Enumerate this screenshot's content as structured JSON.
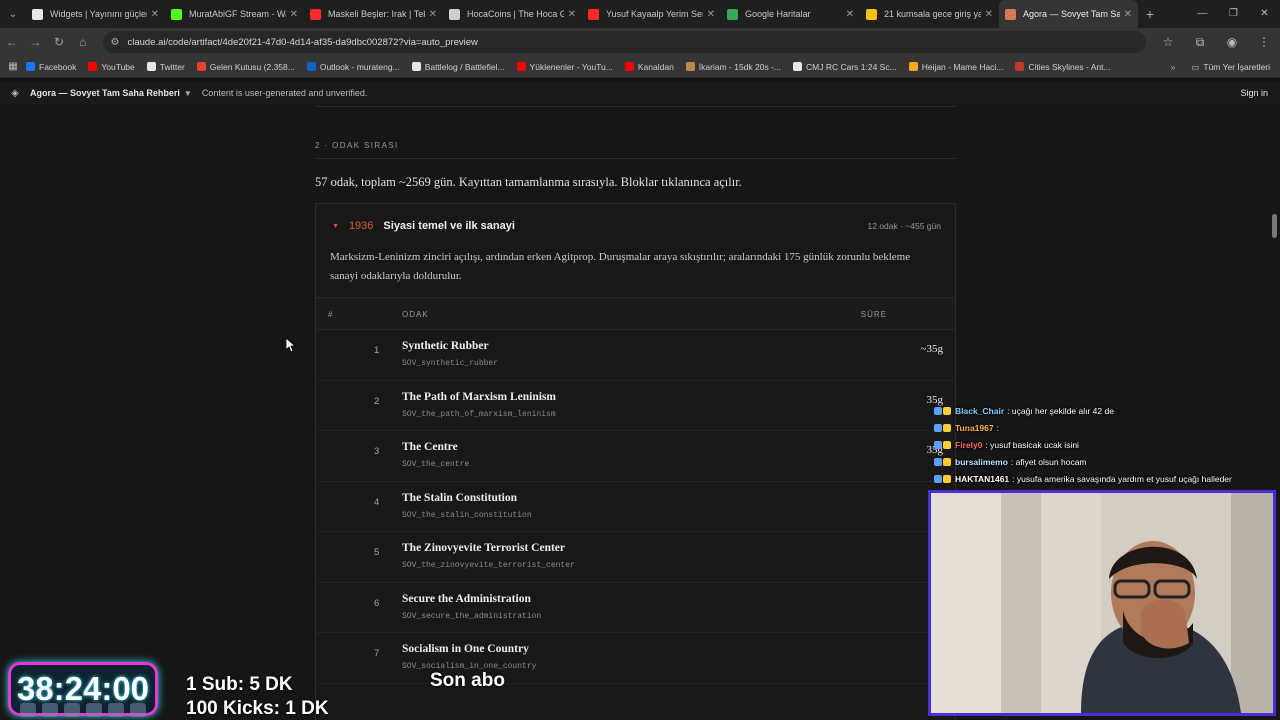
{
  "browser": {
    "tabs": [
      {
        "title": "Widgets | Yayınını güçlen",
        "color": "#e8e8e8"
      },
      {
        "title": "MuratAbiGF Stream - Wa",
        "color": "#53fc18"
      },
      {
        "title": "Maskeli Beşler: Irak | Tek P",
        "color": "#ff2b2b"
      },
      {
        "title": "HocaCoins | The Hoca Ga",
        "color": "#cfcfcf"
      },
      {
        "title": "Yusuf Kayaalp Yerim Seni",
        "color": "#ff2b2b"
      },
      {
        "title": "Google Haritalar",
        "color": "#34a853"
      },
      {
        "title": "21 kumsala gece giriş yas",
        "color": "#f2c300"
      },
      {
        "title": "Agora — Sovyet Tam Saha",
        "color": "#d97757"
      }
    ],
    "url": "claude.ai/code/artifact/4de20f21-47d0-4d14-af35-da9dbc002872?via=auto_preview",
    "bookmarks": [
      {
        "label": "Facebook",
        "color": "#1877f2"
      },
      {
        "label": "YouTube",
        "color": "#ff0000"
      },
      {
        "label": "Twitter",
        "color": "#e6e6e6"
      },
      {
        "label": "Gelen Kutusu (2.358...",
        "color": "#ea4335"
      },
      {
        "label": "Outlook - murateng...",
        "color": "#0a64c8"
      },
      {
        "label": "Battlelog / Battlefiel...",
        "color": "#e6e6e6"
      },
      {
        "label": "Yüklenenler - YouTu...",
        "color": "#ff0000"
      },
      {
        "label": "Kanaldan",
        "color": "#ff0000"
      },
      {
        "label": "İkariam - 15dk 20s -...",
        "color": "#b58a4a"
      },
      {
        "label": "CMJ RC Cars 1:24 Sc...",
        "color": "#e6e6e6"
      },
      {
        "label": "Heijan - Mame Haci...",
        "color": "#f5a623"
      },
      {
        "label": "Cities Skylines - Ant...",
        "color": "#c0392b"
      }
    ],
    "bookmarks_all": "Tüm Yer İşaretleri"
  },
  "artifact": {
    "name": "Agora — Sovyet Tam Saha Rehberi",
    "notice": "Content is user-generated and unverified.",
    "sign_in": "Sign in"
  },
  "section": {
    "label": "2 · ODAK SIRASI",
    "intro": "57 odak, toplam ~2569 gün. Kayıttan tamamlanma sırasıyla. Bloklar tıklanınca açılır."
  },
  "block": {
    "year": "1936",
    "title": "Siyasi temel ve ilk sanayi",
    "meta": "12 odak · ~455 gün",
    "description": "Marksizm-Leninizm zinciri açılışı, ardından erken Agitprop. Duruşmalar araya sıkıştırılır; aralarındaki 175 günlük zorunlu bekleme sanayi odaklarıyla doldurulur.",
    "columns": {
      "num": "#",
      "focus": "ODAK",
      "duration": "SÜRE"
    },
    "rows": [
      {
        "num": "1",
        "name": "Synthetic Rubber",
        "code": "SOV_synthetic_rubber",
        "duration": "~35g"
      },
      {
        "num": "2",
        "name": "The Path of Marxism Leninism",
        "code": "SOV_the_path_of_marxism_leninism",
        "duration": "35g"
      },
      {
        "num": "3",
        "name": "The Centre",
        "code": "SOV_the_centre",
        "duration": "35g"
      },
      {
        "num": "4",
        "name": "The Stalin Constitution",
        "code": "SOV_the_stalin_constitution",
        "duration": ""
      },
      {
        "num": "5",
        "name": "The Zinovyevite Terrorist Center",
        "code": "SOV_the_zinovyevite_terrorist_center",
        "duration": ""
      },
      {
        "num": "6",
        "name": "Secure the Administration",
        "code": "SOV_secure_the_administration",
        "duration": ""
      },
      {
        "num": "7",
        "name": "Socialism in One Country",
        "code": "SOV_socialism_in_one_country",
        "duration": ""
      }
    ]
  },
  "chat": [
    {
      "user": "Black_Chair",
      "user_color": "#7fd3ff",
      "text": ": uçağı her şekilde alır 42 de"
    },
    {
      "user": "Tuna1967",
      "user_color": "#ffb347",
      "text": ":"
    },
    {
      "user": "Firely0",
      "user_color": "#ff6b6b",
      "text": ": yusuf basicak ucak isini"
    },
    {
      "user": "bursalimemo",
      "user_color": "#b9e6ff",
      "text": ": afiyet olsun hocam"
    },
    {
      "user": "HAKTAN1461",
      "user_color": "#ffffff",
      "text": ": yusufa amerika savaşında yardım et yusuf uçağı halleder"
    }
  ],
  "stream": {
    "timer": "38:24:00",
    "goal_sub": "1 Sub: 5 DK",
    "goal_kicks": "100 Kicks: 1 DK",
    "ticker": "Son abo"
  }
}
